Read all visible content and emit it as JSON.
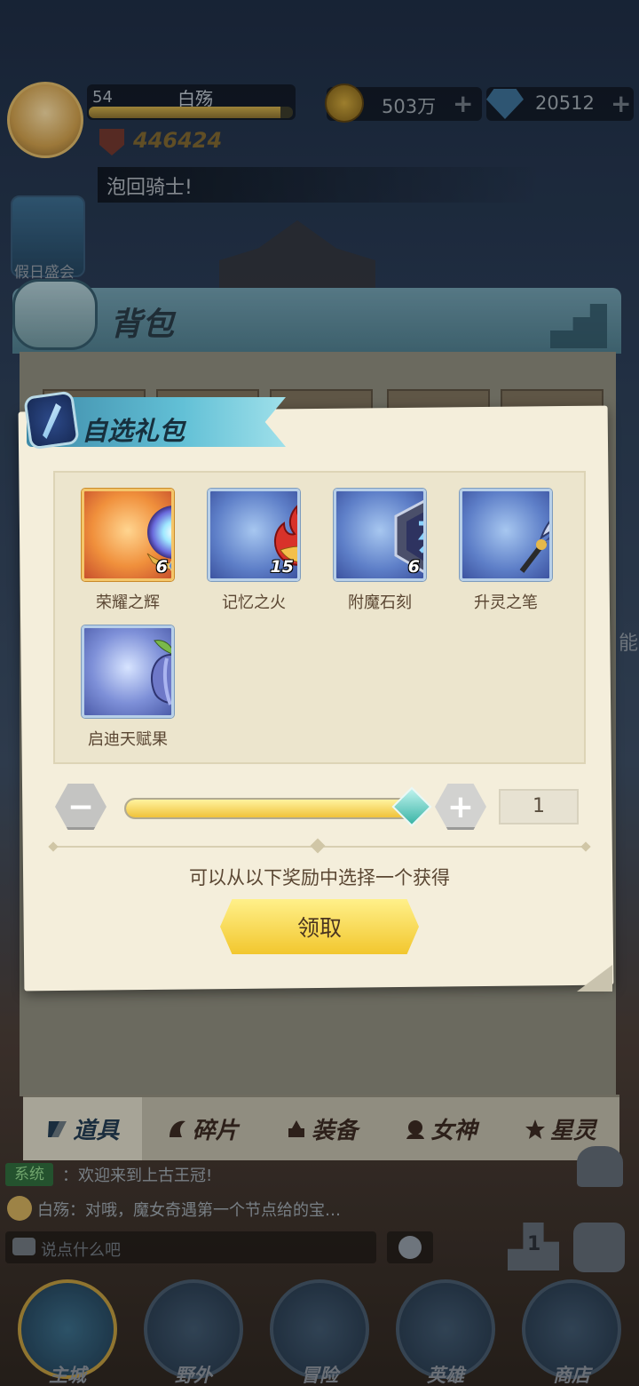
{
  "player": {
    "level": "54",
    "name": "白殇",
    "power": "446424"
  },
  "resources": {
    "gold": "503万",
    "diamonds": "20512"
  },
  "banner_text": "泡回骑士!",
  "event_label": "假日盛会",
  "side_text": "能",
  "backpack": {
    "title": "背包",
    "tabs": [
      {
        "label": "道具"
      },
      {
        "label": "碎片"
      },
      {
        "label": "装备"
      },
      {
        "label": "女神"
      },
      {
        "label": "星灵"
      }
    ]
  },
  "dialog": {
    "title": "自选礼包",
    "items": [
      {
        "name": "荣耀之辉",
        "count": "6",
        "icon": "crystal-orb-icon"
      },
      {
        "name": "记忆之火",
        "count": "15",
        "icon": "fire-icon"
      },
      {
        "name": "附魔石刻",
        "count": "6",
        "icon": "rune-stone-icon"
      },
      {
        "name": "升灵之笔",
        "count": "",
        "icon": "quill-icon"
      },
      {
        "name": "启迪天赋果",
        "count": "",
        "icon": "fruit-icon"
      }
    ],
    "quantity": "1",
    "slider_fraction": 1.0,
    "hint": "可以从以下奖励中选择一个获得",
    "claim_label": "领取"
  },
  "chat": {
    "system_tag": "系统",
    "system_message": "：欢迎来到上古王冠!",
    "user_message": "白殇：对哦，魔女奇遇第一个节点给的宝…",
    "input_placeholder": "说点什么吧"
  },
  "ranking_number": "1",
  "nav": [
    {
      "label": "主城"
    },
    {
      "label": "野外"
    },
    {
      "label": "冒险"
    },
    {
      "label": "英雄"
    },
    {
      "label": "商店"
    }
  ],
  "colors": {
    "accent_yellow": "#f2c72e",
    "ribbon_blue": "#62c0d6",
    "paper": "#f4eedb"
  }
}
